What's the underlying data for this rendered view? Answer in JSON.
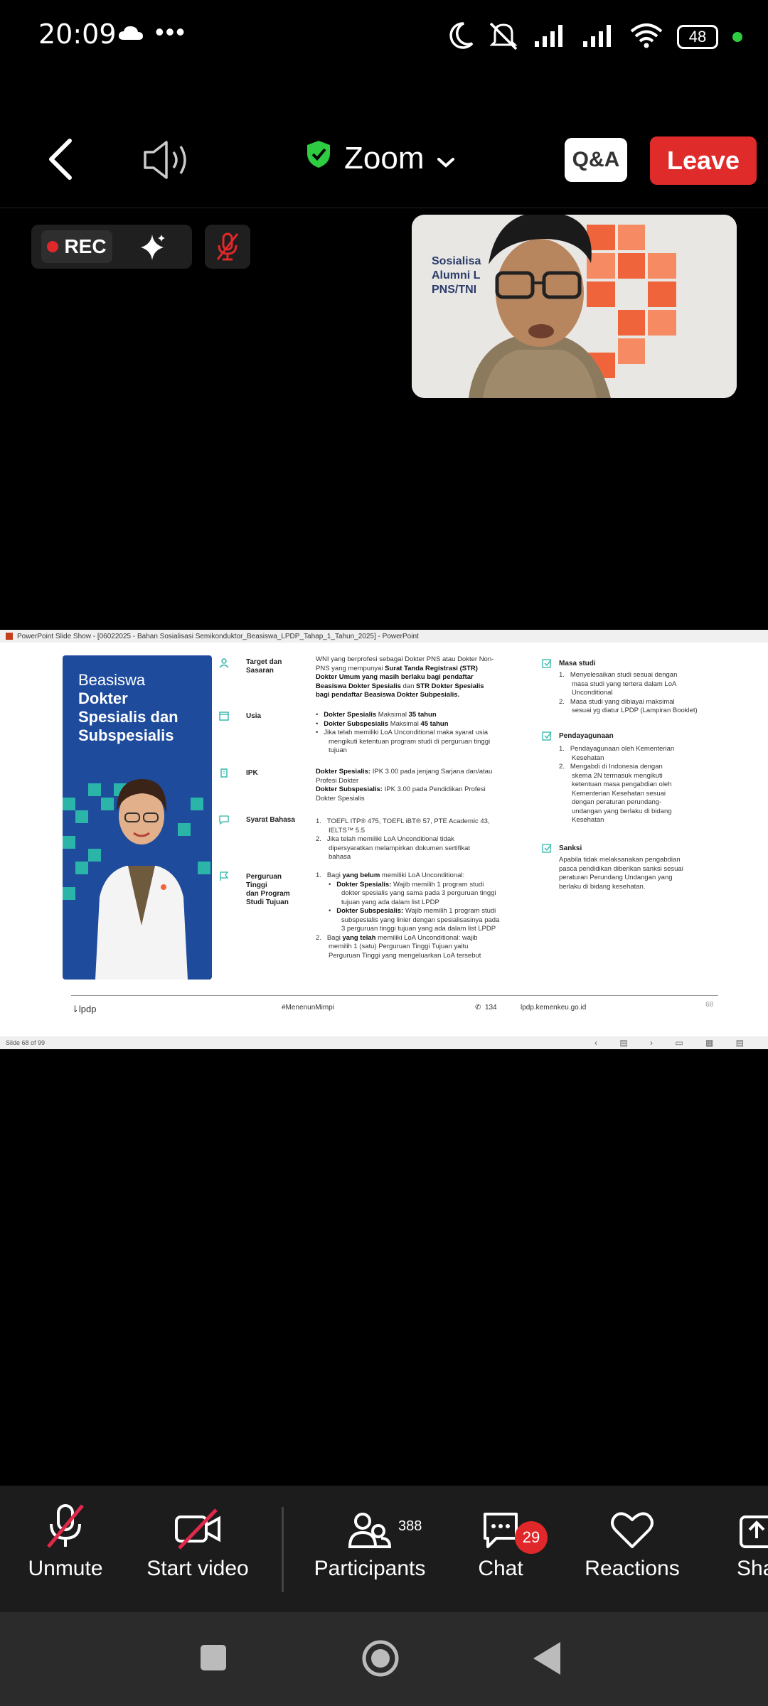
{
  "status": {
    "time": "20:09",
    "dots": "•••",
    "battery": "48"
  },
  "header": {
    "title": "Zoom",
    "qa": "Q&A",
    "leave": "Leave"
  },
  "rec": {
    "label": "REC"
  },
  "ppt": {
    "window_title": "PowerPoint Slide Show - [06022025 - Bahan Sosialisasi Semikonduktor_Beasiswa_LPDP_Tahap_1_Tahun_2025] - PowerPoint",
    "status": "Slide 68 of 99"
  },
  "thumb": {
    "text1": "Sosialisa",
    "text2": "Alumni L",
    "text3": "PNS/TNI"
  },
  "slide": {
    "panel_title_1": "Beasiswa",
    "panel_title_2": "Dokter",
    "panel_title_3": "Spesialis dan",
    "panel_title_4": "Subspesialis",
    "target_label_1": "Target dan",
    "target_label_2": "Sasaran",
    "target_1": "WNI yang berprofesi sebagai Dokter PNS atau Dokter Non-",
    "target_2a": "PNS yang  mempunyai ",
    "target_2b": "Surat Tanda Registrasi (STR)",
    "target_3": "Dokter Umum yang masih berlaku bagi pendaftar",
    "target_4a": "Beasiswa Dokter Spesialis",
    "target_4b": " dan ",
    "target_4c": "STR Dokter Spesialis",
    "target_5": "bagi pendaftar Beasiswa Dokter Subpesialis.",
    "usia_label": "Usia",
    "usia_1a": "Dokter Spesialis",
    "usia_1b": " Maksimal ",
    "usia_1c": "35 tahun",
    "usia_2a": "Dokter Subspesialis",
    "usia_2b": " Maksimal ",
    "usia_2c": "45 tahun",
    "usia_3": "Jika  telah  memiliki  LoA  Unconditional  maka syarat usia",
    "usia_4": "mengikuti ketentuan  program studi di perguruan tinggi",
    "usia_5": "tujuan",
    "ipk_label": "IPK",
    "ipk_1a": "Dokter Spesialis:",
    "ipk_1b": " IPK 3.00 pada jenjang Sarjana dan/atau",
    "ipk_2": "Profesi Dokter",
    "ipk_3a": "Dokter Subspesialis:",
    "ipk_3b": " IPK 3.00 pada Pendidikan Profesi",
    "ipk_4": "Dokter Spesialis",
    "bahasa_label": "Syarat Bahasa",
    "bahasa_1": "TOEFL ITP® 475, TOEFL iBT® 57, PTE Academic 43,",
    "bahasa_2": "IELTS™ 5.5",
    "bahasa_3": "Jika telah memiliki LoA Unconditional tidak",
    "bahasa_4": "dipersyaratkan melampirkan dokumen sertifikat",
    "bahasa_5": "bahasa",
    "pt_label_1": "Perguruan",
    "pt_label_2": "Tinggi",
    "pt_label_3": "dan Program",
    "pt_label_4": "Studi Tujuan",
    "pt_1a": "Bagi ",
    "pt_1b": "yang belum",
    "pt_1c": " memiliki LoA Unconditional:",
    "pt_2a": "Dokter Spesialis:",
    "pt_2b": " Wajib memilih 1 program studi",
    "pt_3": "dokter spesialis yang sama pada 3 perguruan tinggi",
    "pt_4": "tujuan yang ada dalam list LPDP",
    "pt_5a": "Dokter Subspesialis:",
    "pt_5b": " Wajib memilih 1 program studi",
    "pt_6": "subspesialis yang linier dengan spesialisasinya pada",
    "pt_7": "3 perguruan tinggi tujuan yang  ada dalam list LPDP",
    "pt_8a": "Bagi ",
    "pt_8b": "yang telah",
    "pt_8c": " memiliki LoA Unconditional: wajib",
    "pt_9": "memilih 1 (satu) Perguruan  Tinggi Tujuan yaitu",
    "pt_10": "Perguruan Tinggi yang mengeluarkan LoA tersebut",
    "masa_label": "Masa studi",
    "masa_1": "Menyelesaikan studi sesuai dengan",
    "masa_2": "masa studi yang tertera dalam LoA",
    "masa_3": "Unconditional",
    "masa_4": "Masa studi yang dibiayai maksimal",
    "masa_5": "sesuai yg diatur LPDP (Lampiran Booklet)",
    "penda_label": "Pendayagunaan",
    "penda_1": "Pendayagunaan oleh Kementerian",
    "penda_2": "Kesehatan",
    "penda_3": "Mengabdi di Indonesia dengan",
    "penda_4": "skema 2N termasuk mengikuti",
    "penda_5": "ketentuan masa pengabdian oleh",
    "penda_6": "Kementerian  Kesehatan sesuai",
    "penda_7": "dengan peraturan perundang-",
    "penda_8": "undangan yang berlaku di bidang",
    "penda_9": "Kesehatan",
    "sanksi_label": "Sanksi",
    "sanksi_1": "Apabila tidak melaksanakan pengabdian",
    "sanksi_2": "pasca pendidikan diberikan sanksi sesuai",
    "sanksi_3": "peraturan Perundang Undangan yang",
    "sanksi_4": "berlaku di bidang kesehatan.",
    "footer_logo": "lpdp",
    "footer_hashtag": "#MenenunMimpi",
    "footer_phone": "134",
    "footer_web": "lpdp.kemenkeu.go.id",
    "footer_page": "68"
  },
  "controls": {
    "unmute": "Unmute",
    "start_video": "Start video",
    "participants": "Participants",
    "participants_count": "388",
    "chat": "Chat",
    "chat_badge": "29",
    "reactions": "Reactions",
    "share": "Sha"
  },
  "icons": [
    "cloud-icon",
    "moon-icon",
    "muted-bell-icon",
    "signal-icon",
    "wifi-icon",
    "battery-icon",
    "back-icon",
    "speaker-icon",
    "shield-check-icon",
    "chevron-down-icon",
    "sparkle-icon",
    "mic-off-icon",
    "video-off-icon",
    "participants-icon",
    "chat-icon",
    "heart-icon",
    "share-icon",
    "recents-icon",
    "home-icon",
    "back-nav-icon"
  ],
  "colors": {
    "leave": "#e02b2b",
    "shield": "#2ecc40",
    "slide_blue": "#1e4b9c",
    "teal": "#2bb5a8",
    "badge": "#e0282a"
  }
}
